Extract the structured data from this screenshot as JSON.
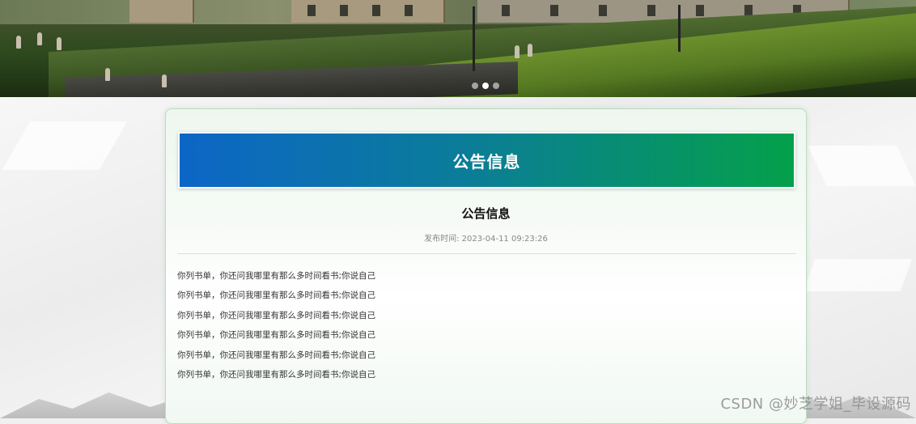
{
  "carousel": {
    "slides": 3,
    "active_index": 1
  },
  "notice_panel": {
    "header": "公告信息",
    "title": "公告信息",
    "publish_label": "发布时间:",
    "publish_time": "2023-04-11 09:23:26",
    "paragraphs": [
      "你列书单，你还问我哪里有那么多时间看书;你说自己",
      "你列书单，你还问我哪里有那么多时间看书;你说自己",
      "你列书单，你还问我哪里有那么多时间看书;你说自己",
      "你列书单，你还问我哪里有那么多时间看书;你说自己",
      "你列书单，你还问我哪里有那么多时间看书;你说自己",
      "你列书单，你还问我哪里有那么多时间看书;你说自己"
    ]
  },
  "watermark": "CSDN @妙芝学姐_毕设源码",
  "colors": {
    "header_gradient_start": "#0c66c6",
    "header_gradient_end": "#04a04a",
    "panel_border": "#b9ddc1"
  }
}
